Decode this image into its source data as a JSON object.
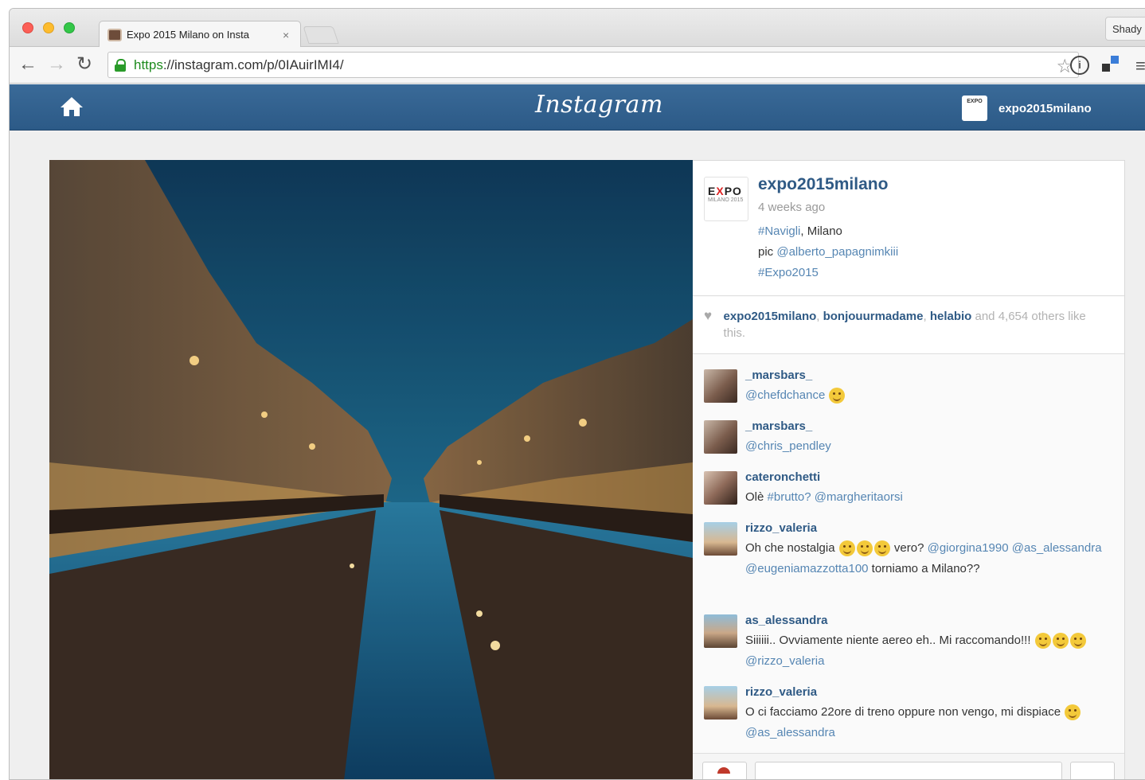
{
  "browser": {
    "tab_title": "Expo 2015 Milano on Insta",
    "tab_close": "×",
    "profile_label": "Shady",
    "url_scheme": "https",
    "url_rest": "://instagram.com/p/0IAuirIMI4/"
  },
  "instagram": {
    "logo_text": "Instagram",
    "current_user": "expo2015milano",
    "current_user_avatar_text": "EXPO"
  },
  "post": {
    "author": "expo2015milano",
    "avatar_mark_e": "E",
    "avatar_mark_x": "X",
    "avatar_mark_po": "PO",
    "avatar_sub": "MILANO 2015",
    "time": "4 weeks ago",
    "caption_tag1": "#Navigli",
    "caption_place": ", Milano",
    "caption_pic": "pic ",
    "caption_mention": "@alberto_papagnimkiii",
    "caption_tag2": "#Expo2015"
  },
  "likes": {
    "user1": "expo2015milano",
    "sep1": ", ",
    "user2": "bonjouurmadame",
    "sep2": ", ",
    "user3": "helabio",
    "rest": " and 4,654 others like this."
  },
  "comments": [
    {
      "user": "_marsbars_",
      "pre": "",
      "mention": "@chefdchance",
      "post": ""
    },
    {
      "user": "_marsbars_",
      "pre": "",
      "mention": "@chris_pendley",
      "post": ""
    },
    {
      "user": "cateronchetti",
      "pre": "Olè ",
      "mention": "#brutto? @margheritaorsi",
      "post": ""
    },
    {
      "user": "rizzo_valeria",
      "pre": "Oh che nostalgia ",
      "mid": " vero? ",
      "mention": "@giorgina1990 @as_alessandra @eugeniamazzotta100",
      "post": " torniamo a Milano??"
    },
    {
      "user": "as_alessandra",
      "pre": "Siiiiii.. Ovviamente niente aereo eh.. Mi raccomando!!! ",
      "mention": "@rizzo_valeria",
      "post": ""
    },
    {
      "user": "rizzo_valeria",
      "pre": "O ci facciamo 22ore di treno oppure non vengo, mi dispiace ",
      "mention": "@as_alessandra",
      "post": ""
    }
  ],
  "colors": {
    "instagram_bar": "#2c5a87",
    "link_blue": "#2f5a85",
    "tag_blue": "#5686b3"
  }
}
